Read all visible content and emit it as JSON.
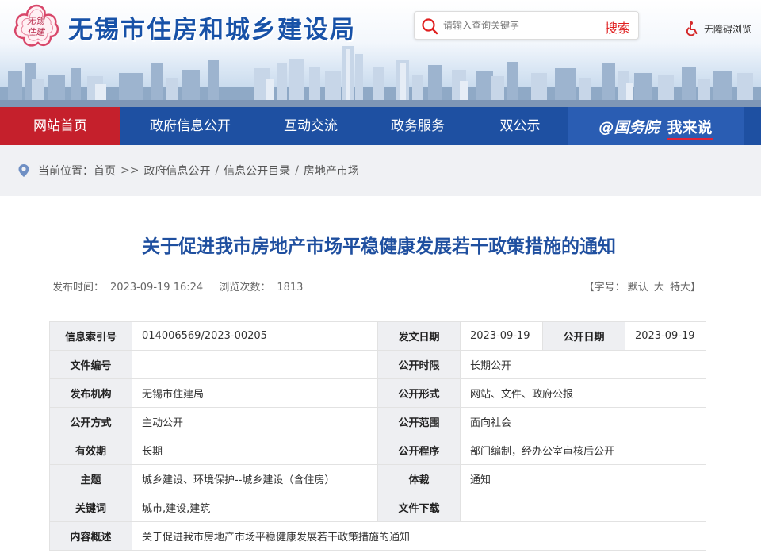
{
  "header": {
    "site_title": "无锡市住房和城乡建设局",
    "logo_text": "无锡住建",
    "search": {
      "placeholder": "请输入查询关键字",
      "button_label": "搜索"
    },
    "accessibility_label": "无障碍浏览"
  },
  "nav": {
    "items": [
      {
        "label": "网站首页",
        "active": true
      },
      {
        "label": "政府信息公开",
        "active": false
      },
      {
        "label": "互动交流",
        "active": false
      },
      {
        "label": "政务服务",
        "active": false
      },
      {
        "label": "双公示",
        "active": false
      }
    ],
    "special": {
      "prefix": "@国务院",
      "label": "我来说"
    }
  },
  "breadcrumb": {
    "prefix": "当前位置：",
    "items": [
      "首页",
      "政府信息公开",
      "信息公开目录",
      "房地产市场"
    ],
    "first_separator": ">>",
    "separator": "/"
  },
  "article": {
    "title": "关于促进我市房地产市场平稳健康发展若干政策措施的通知",
    "publish_label": "发布时间：",
    "publish_time": "2023-09-19 16:24",
    "views_label": "浏览次数：",
    "views": "1813",
    "font_size_label": "【字号：",
    "font_size_options": [
      "默认",
      "大",
      "特大"
    ],
    "font_size_end": "】"
  },
  "info_table": {
    "index_label": "信息索引号",
    "index_value": "014006569/2023-00205",
    "issue_date_label": "发文日期",
    "issue_date_value": "2023-09-19",
    "public_date_label": "公开日期",
    "public_date_value": "2023-09-19",
    "doc_no_label": "文件编号",
    "doc_no_value": "",
    "public_period_label": "公开时限",
    "public_period_value": "长期公开",
    "issuer_label": "发布机构",
    "issuer_value": "无锡市住建局",
    "public_form_label": "公开形式",
    "public_form_value": "网站、文件、政府公报",
    "public_method_label": "公开方式",
    "public_method_value": "主动公开",
    "public_scope_label": "公开范围",
    "public_scope_value": "面向社会",
    "validity_label": "有效期",
    "validity_value": "长期",
    "public_procedure_label": "公开程序",
    "public_procedure_value": "部门编制，经办公室审核后公开",
    "subject_label": "主题",
    "subject_value": "城乡建设、环境保护--城乡建设（含住房）",
    "genre_label": "体裁",
    "genre_value": "通知",
    "keywords_label": "关键词",
    "keywords_value": "城市,建设,建筑",
    "download_label": "文件下载",
    "download_value": "",
    "summary_label": "内容概述",
    "summary_value": "关于促进我市房地产市场平稳健康发展若干政策措施的通知"
  },
  "colors": {
    "nav_bg": "#1e50a2",
    "nav_active": "#c5202c",
    "title_blue": "#1f4f9f",
    "search_red": "#e02020"
  }
}
